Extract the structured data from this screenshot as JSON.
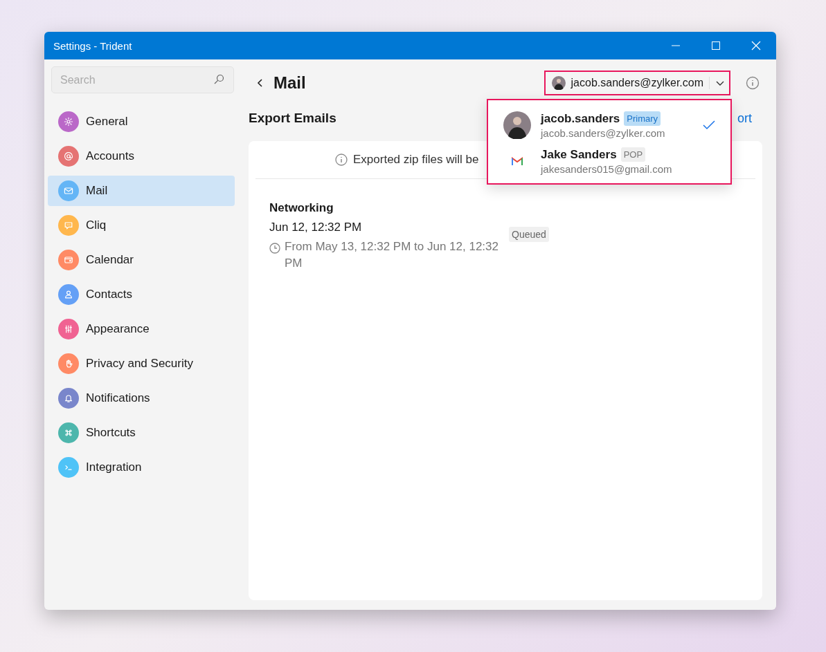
{
  "window": {
    "title": "Settings - Trident"
  },
  "search": {
    "placeholder": "Search"
  },
  "sidebar": {
    "items": [
      {
        "label": "General",
        "kind": "gear",
        "color": "#ba68c8",
        "selected": false
      },
      {
        "label": "Accounts",
        "kind": "at",
        "color": "#e57373",
        "selected": false
      },
      {
        "label": "Mail",
        "kind": "mail",
        "color": "#64b5f6",
        "selected": true
      },
      {
        "label": "Cliq",
        "kind": "chat",
        "color": "#ffb74d",
        "selected": false
      },
      {
        "label": "Calendar",
        "kind": "wallet",
        "color": "#ff8a65",
        "selected": false
      },
      {
        "label": "Contacts",
        "kind": "person",
        "color": "#64a0f6",
        "selected": false
      },
      {
        "label": "Appearance",
        "kind": "sliders",
        "color": "#f06292",
        "selected": false
      },
      {
        "label": "Privacy and Security",
        "kind": "hand",
        "color": "#ff8a65",
        "selected": false
      },
      {
        "label": "Notifications",
        "kind": "bell",
        "color": "#7986cb",
        "selected": false
      },
      {
        "label": "Shortcuts",
        "kind": "command",
        "color": "#4db6ac",
        "selected": false
      },
      {
        "label": "Integration",
        "kind": "terminal",
        "color": "#4fc3f7",
        "selected": false
      }
    ]
  },
  "header": {
    "title": "Mail",
    "account": "jacob.sanders@zylker.com"
  },
  "section": {
    "title": "Export Emails",
    "link": "ort"
  },
  "info": "Exported zip files will be",
  "exports": [
    {
      "name": "Networking",
      "date": "Jun 12, 12:32 PM",
      "range": "From May 13, 12:32 PM to Jun 12, 12:32 PM",
      "status": "Queued"
    }
  ],
  "account_menu": {
    "accounts": [
      {
        "name": "jacob.sanders",
        "email": "jacob.sanders@zylker.com",
        "kind": "photo",
        "badge": {
          "text": "Primary",
          "kind": "primary"
        },
        "selected": true
      },
      {
        "name": "Jake Sanders",
        "email": "jakesanders015@gmail.com",
        "kind": "gmail",
        "badge": {
          "text": "POP",
          "kind": "plain"
        },
        "selected": false
      }
    ]
  }
}
